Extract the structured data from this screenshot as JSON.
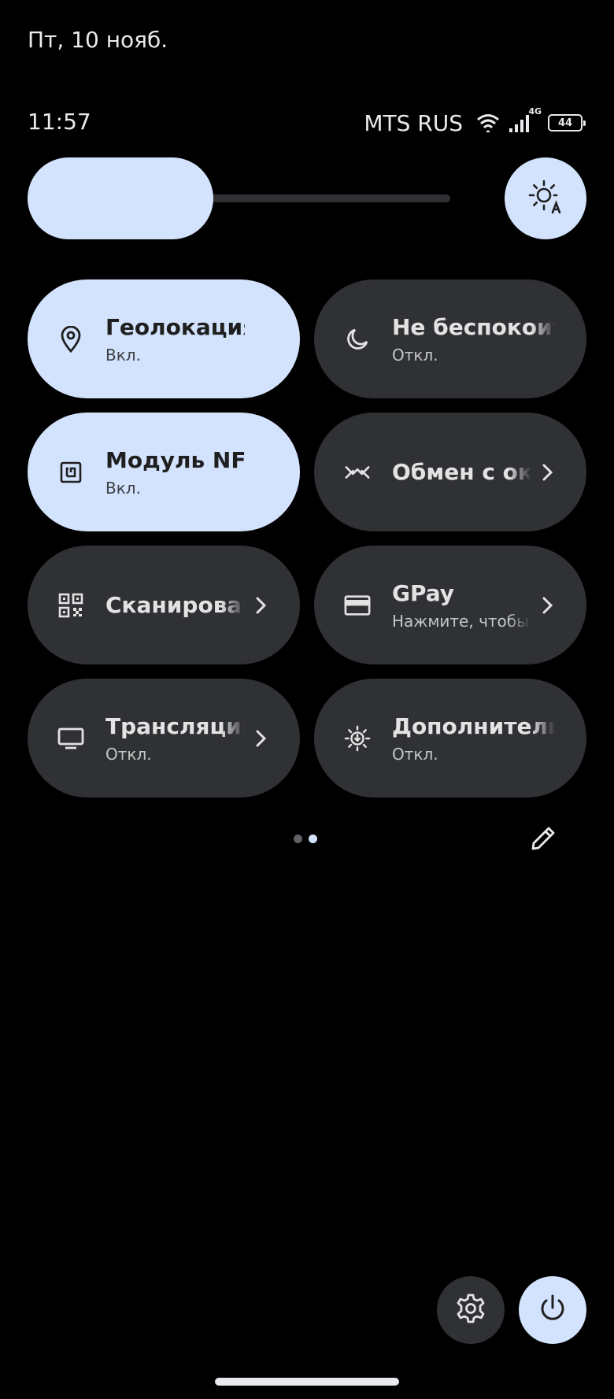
{
  "header": {
    "date": "Пт, 10 нояб.",
    "time": "11:57"
  },
  "status": {
    "carrier": "MTS RUS",
    "network": "4G",
    "battery": "44",
    "icons": [
      "wifi-icon",
      "signal-icon",
      "battery-icon"
    ]
  },
  "brightness": {
    "level": 0.44,
    "icon": "auto-brightness-icon"
  },
  "tiles": [
    {
      "title": "Геолокация",
      "subtitle": "Вкл.",
      "state": "on",
      "icon": "location-pin-icon"
    },
    {
      "title": "Не беспокоить",
      "subtitle": "Откл.",
      "state": "off",
      "icon": "moon-icon"
    },
    {
      "title": "Модуль NFC",
      "subtitle": "Вкл.",
      "state": "on",
      "icon": "nfc-icon"
    },
    {
      "title": "Обмен с окружением",
      "subtitle": "",
      "state": "off",
      "icon": "nearby-share-icon"
    },
    {
      "title": "Сканирование",
      "subtitle": "",
      "state": "off",
      "icon": "qr-code-icon"
    },
    {
      "title": "GPay",
      "subtitle": "Нажмите, чтобы",
      "state": "off",
      "icon": "card-icon"
    },
    {
      "title": "Трансляция",
      "subtitle": "Откл.",
      "state": "off",
      "icon": "cast-screen-icon"
    },
    {
      "title": "Дополнительное",
      "subtitle": "Откл.",
      "state": "off",
      "icon": "extra-dim-icon"
    }
  ],
  "pager": {
    "pages": 2,
    "current": 2
  },
  "colors": {
    "background": "#000000",
    "tile_on": "#d3e3fd",
    "tile_off": "#303134"
  }
}
